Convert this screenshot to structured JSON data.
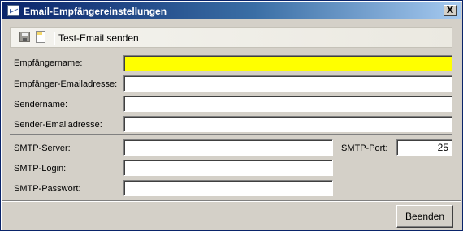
{
  "window": {
    "title": "Email-Empfängereinstellungen",
    "close_label": "X"
  },
  "toolbar": {
    "save_icon": "save-icon",
    "new_icon": "new-document-icon",
    "test_email_label": "Test-Email senden"
  },
  "form": {
    "recipient_name_label": "Empfängername:",
    "recipient_name_value": "",
    "recipient_email_label": "Empfänger-Emailadresse:",
    "recipient_email_value": "",
    "sender_name_label": "Sendername:",
    "sender_name_value": "",
    "sender_email_label": "Sender-Emailadresse:",
    "sender_email_value": "",
    "smtp_server_label": "SMTP-Server:",
    "smtp_server_value": "",
    "smtp_port_label": "SMTP-Port:",
    "smtp_port_value": "25",
    "smtp_login_label": "SMTP-Login:",
    "smtp_login_value": "",
    "smtp_password_label": "SMTP-Passwort:",
    "smtp_password_value": ""
  },
  "footer": {
    "close_button_label": "Beenden"
  },
  "colors": {
    "active_field": "#ffff00",
    "titlebar_start": "#0a246a",
    "titlebar_end": "#a6caf0",
    "face": "#d4d0c8"
  }
}
